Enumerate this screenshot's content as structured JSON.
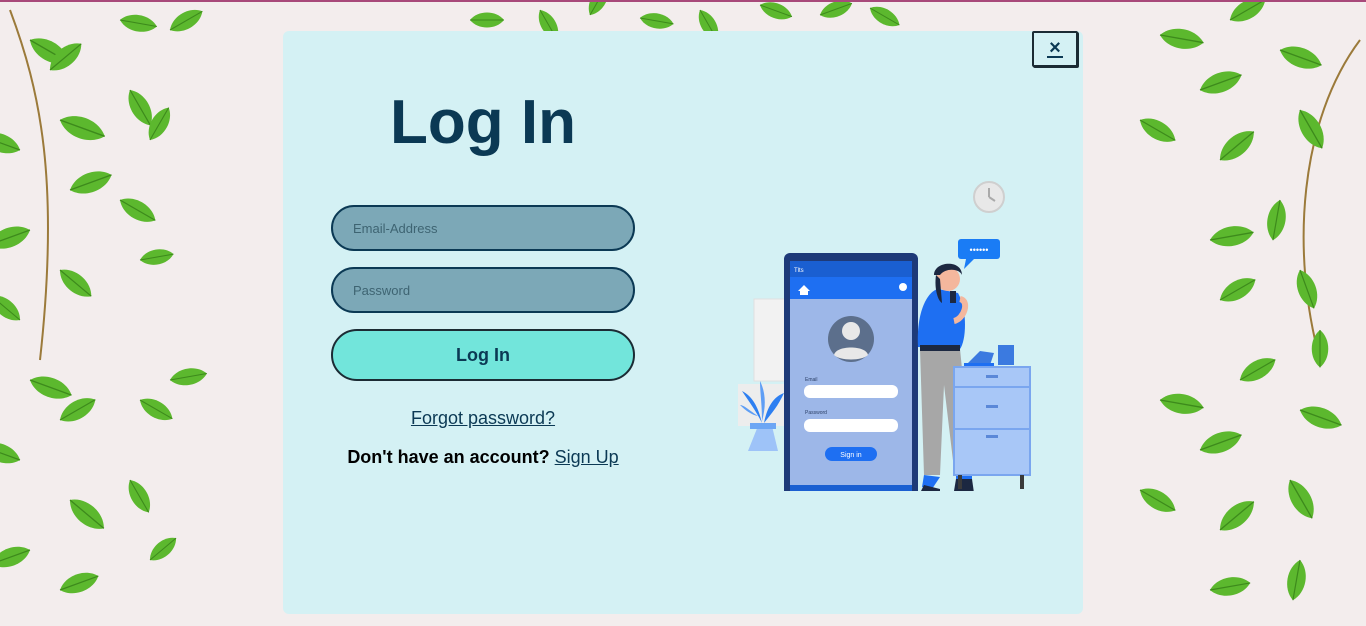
{
  "modal": {
    "close_label": "×",
    "title": "Log In",
    "email_placeholder": "Email-Address",
    "password_placeholder": "Password",
    "login_label": "Log In",
    "forgot_label": "Forgot password?",
    "signup_prompt": "Don't have an account?",
    "signup_label": "Sign Up"
  },
  "illustration": {
    "email_label": "Email",
    "password_label": "Password",
    "signin_label": "Sign in",
    "status_label": "Tlts",
    "chat_text": "••••••"
  },
  "colors": {
    "modal_bg": "#d4f1f4",
    "primary_dark": "#0b3954",
    "input_bg": "#7ca8b7",
    "button_bg": "#72e5db",
    "leaf_green": "#5cb82e"
  }
}
